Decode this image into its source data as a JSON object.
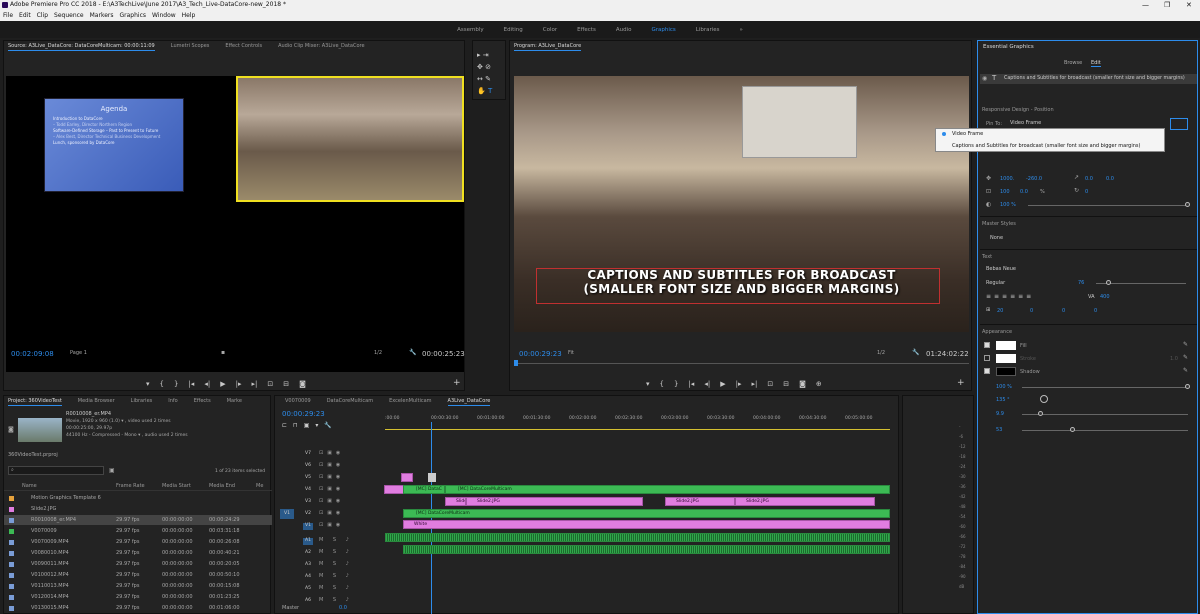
{
  "titlebar": {
    "title": "Adobe Premiere Pro CC 2018 - E:\\A3TechLive\\June 2017\\A3_Tech_Live-DataCore-new_2018 *"
  },
  "menubar": {
    "items": [
      "File",
      "Edit",
      "Clip",
      "Sequence",
      "Markers",
      "Graphics",
      "Window",
      "Help"
    ]
  },
  "workspaces": {
    "items": [
      "Assembly",
      "Editing",
      "Color",
      "Effects",
      "Audio",
      "Graphics",
      "Libraries"
    ],
    "more": "»"
  },
  "source": {
    "tabs": [
      "Source: A3Live_DataCore: DataCoreMulticam: 00:00:11:09",
      "Lumetri Scopes",
      "Effect Controls",
      "Audio Clip Mixer: A3Live_DataCore"
    ],
    "timecode": "00:02:09:08",
    "page": "Page 1",
    "zoom": "1/2",
    "duration": "00:00:25:23",
    "slide": {
      "title": "Agenda",
      "lines": [
        "Introduction to DataCore",
        "– Todd Earley, Director Northern Region",
        "Software-Defined Storage – Past to Present to Future",
        "– Alex Best, Director Technical Business Development",
        "Lunch, sponsored by DataCore"
      ]
    }
  },
  "program": {
    "tab": "Program: A3Live_DataCore",
    "timecode": "00:00:29:23",
    "fit": "Fit",
    "zoom": "1/2",
    "duration": "01:24:02:22",
    "caption_line1": "CAPTIONS AND SUBTITLES FOR BROADCAST",
    "caption_line2": "(SMALLER FONT SIZE AND BIGGER MARGINS)"
  },
  "project": {
    "tabs": [
      "Project: 360VideoTest",
      "Media Browser",
      "Libraries",
      "Info",
      "Effects",
      "Marke"
    ],
    "clip_name": "R0010008_er.MP4",
    "clip_info1": "Movie, 1920 x 960 (1.0)  ▾ , video used 2 times",
    "clip_info2": "00:00:25:00, 29.97p",
    "clip_info3": "44100 Hz - Compressed - Mono  ▾ , audio used 2 times",
    "bin": "360VideoTest.prproj",
    "count": "1 of 23 items selected",
    "search_placeholder": "",
    "columns": [
      "Name",
      "Frame Rate",
      "Media Start",
      "Media End",
      "Me"
    ],
    "rows": [
      {
        "name": "Motion Graphics Template 6",
        "rate": "",
        "start": "",
        "end": "",
        "color": "#e6a23c"
      },
      {
        "name": "Slide2.JPG",
        "rate": "",
        "start": "",
        "end": "",
        "color": "#e07de0"
      },
      {
        "name": "R0010008_er.MP4",
        "rate": "29.97 fps",
        "start": "00:00:00:00",
        "end": "00:00:24:29",
        "color": "#7a9cd6"
      },
      {
        "name": "V0070009",
        "rate": "29.97 fps",
        "start": "00:00:00:00",
        "end": "00:03:31:18",
        "color": "#3cba54"
      },
      {
        "name": "V0070009.MP4",
        "rate": "29.97 fps",
        "start": "00:00:00:00",
        "end": "00:00:26:08",
        "color": "#7a9cd6"
      },
      {
        "name": "V0080010.MP4",
        "rate": "29.97 fps",
        "start": "00:00:00:00",
        "end": "00:00:40:21",
        "color": "#7a9cd6"
      },
      {
        "name": "V0090011.MP4",
        "rate": "29.97 fps",
        "start": "00:00:00:00",
        "end": "00:00:20:05",
        "color": "#7a9cd6"
      },
      {
        "name": "V0100012.MP4",
        "rate": "29.97 fps",
        "start": "00:00:00:00",
        "end": "00:00:50:10",
        "color": "#7a9cd6"
      },
      {
        "name": "V0110013.MP4",
        "rate": "29.97 fps",
        "start": "00:00:00:00",
        "end": "00:00:15:08",
        "color": "#7a9cd6"
      },
      {
        "name": "V0120014.MP4",
        "rate": "29.97 fps",
        "start": "00:00:00:00",
        "end": "00:01:23:25",
        "color": "#7a9cd6"
      },
      {
        "name": "V0130015.MP4",
        "rate": "29.97 fps",
        "start": "00:00:00:00",
        "end": "00:01:06:00",
        "color": "#7a9cd6"
      }
    ]
  },
  "timeline": {
    "tabs": [
      "V0070009",
      "DataCoreMulticam",
      "ExcelenMulticam",
      "A3Live_DataCore"
    ],
    "timecode": "00:00:29:23",
    "ruler": [
      ":00:00",
      "00:00:30:00",
      "00:01:00:00",
      "00:01:30:00",
      "00:02:00:00",
      "00:02:30:00",
      "00:03:00:00",
      "00:03:30:00",
      "00:04:00:00",
      "00:04:30:00",
      "00:05:00:00"
    ],
    "tracks": [
      "V7",
      "V6",
      "V5",
      "V4",
      "V3",
      "V2",
      "V1",
      "A1",
      "A2",
      "A3",
      "A4",
      "A5",
      "A6"
    ],
    "master": "Master",
    "master_val": "0.0",
    "clips": {
      "mc": "[MC] DataCoreMulticam",
      "mc_short": "[MC] DataC",
      "slide": "Slide2.JPG",
      "slide_short": "Slide2",
      "white": "White"
    }
  },
  "essential": {
    "title": "Essential Graphics",
    "tabs": [
      "Browse",
      "Edit"
    ],
    "layer": "Captions and Subtitles for broadcast (smaller font size and bigger margins)",
    "responsive": "Responsive Design - Position",
    "pin_to": "Pin To:",
    "pin_value": "Video Frame",
    "dropdown": [
      "Video Frame",
      "Captions and Subtitles for broadcast (smaller font size and bigger margins)"
    ],
    "pos_x": "1000.",
    "pos_y": "-260.0",
    "rot": "0.0",
    "rot2": "0.0",
    "scale": "100",
    "scale2": "0.0",
    "percent": "%",
    "anchor": "0",
    "opacity": "100 %",
    "master_styles": "Master Styles",
    "style_value": "None",
    "text": "Text",
    "font": "Bebas Neue",
    "weight": "Regular",
    "size": "76",
    "tracking": "400",
    "v1": "20",
    "v2": "0",
    "v3": "0",
    "v4": "0",
    "appearance": "Appearance",
    "fill": "Fill",
    "stroke": "Stroke",
    "stroke_val": "1.0",
    "shadow": "Shadow",
    "sh_opacity": "100 %",
    "sh_angle": "135 °",
    "sh_distance": "9.9",
    "sh_size": "53"
  }
}
